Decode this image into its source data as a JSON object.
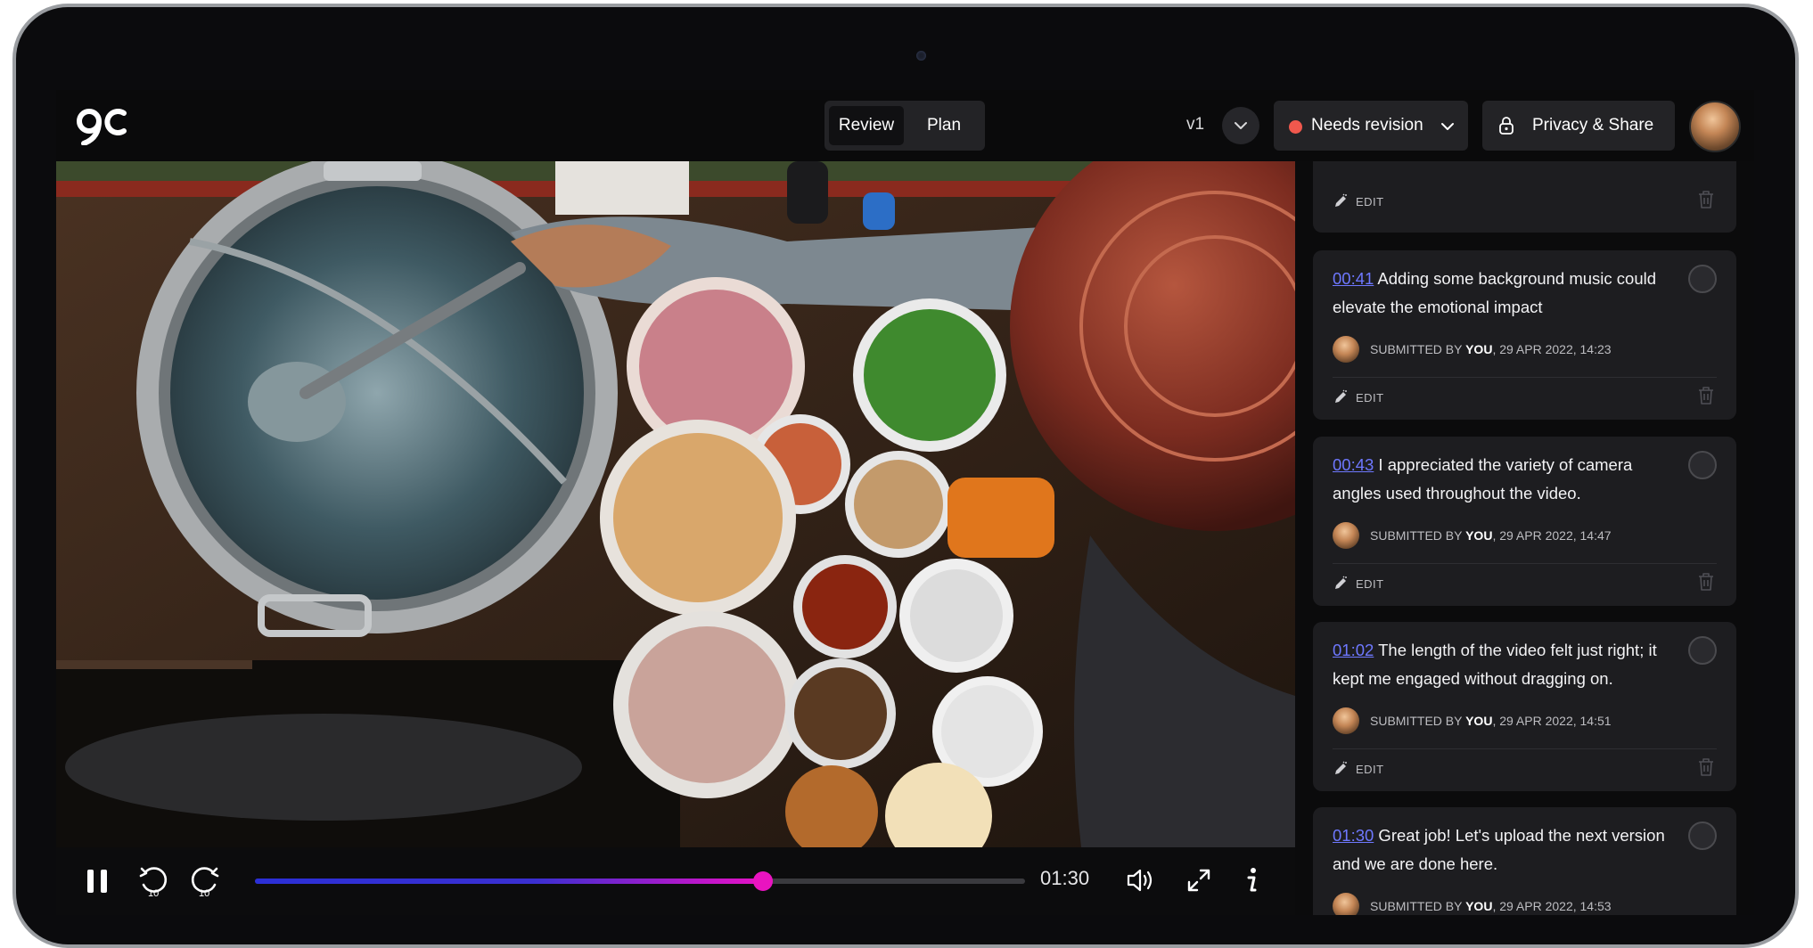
{
  "header": {
    "tabs": [
      "Review",
      "Plan"
    ],
    "active_tab": "Review",
    "version": "v1",
    "status": {
      "label": "Needs revision",
      "color": "#f0584d"
    },
    "share_label": "Privacy & Share"
  },
  "player": {
    "current_time": "01:30",
    "progress": 0.66,
    "rewind_seconds": "10",
    "forward_seconds": "10",
    "accent": "#e914c0"
  },
  "comments": [
    {
      "time": "",
      "text": "",
      "submitted_by_prefix": "",
      "submitted_by": "",
      "date": "",
      "edit": "EDIT"
    },
    {
      "time": "00:41",
      "text": " Adding some background music could elevate the emotional impact",
      "submitted_by_prefix": "SUBMITTED BY ",
      "submitted_by": "YOU",
      "date": ", 29 APR 2022, 14:23",
      "edit": "EDIT"
    },
    {
      "time": "00:43",
      "text": " I appreciated the variety of camera angles used throughout the video.",
      "submitted_by_prefix": "SUBMITTED BY ",
      "submitted_by": "YOU",
      "date": ", 29 APR 2022, 14:47",
      "edit": "EDIT"
    },
    {
      "time": "01:02",
      "text": " The length of the video felt just right; it kept me engaged without dragging on.",
      "submitted_by_prefix": "SUBMITTED BY ",
      "submitted_by": "YOU",
      "date": ", 29 APR 2022, 14:51",
      "edit": "EDIT"
    },
    {
      "time": "01:30",
      "text": " Great job! Let's upload the next version and we are done here.",
      "submitted_by_prefix": "SUBMITTED BY ",
      "submitted_by": "YOU",
      "date": ", 29 APR 2022, 14:53",
      "edit": ""
    }
  ]
}
